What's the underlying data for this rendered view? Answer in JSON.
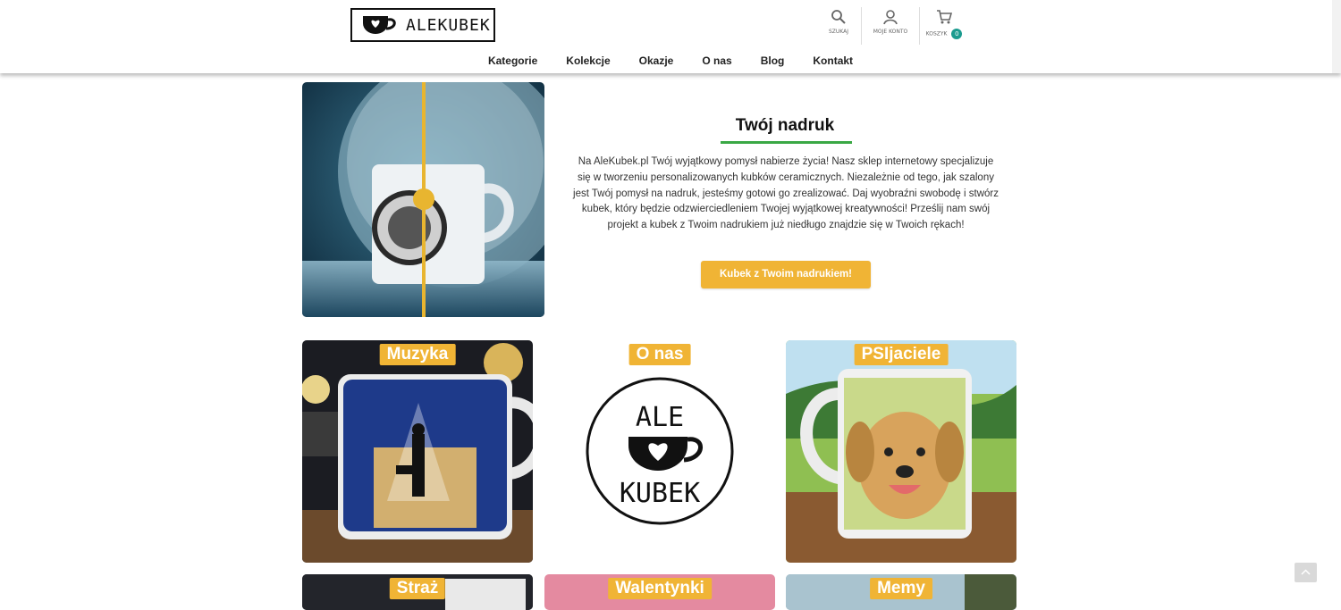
{
  "brand": {
    "logo_text": "ALEKUBEK"
  },
  "header_utils": {
    "search_label": "SZUKAJ",
    "account_label": "MOJE KONTO",
    "cart_label": "KOSZYK",
    "cart_count": "0"
  },
  "nav": {
    "items": [
      "Kategorie",
      "Kolekcje",
      "Okazje",
      "O nas",
      "Blog",
      "Kontakt"
    ]
  },
  "hero": {
    "title": "Twój nadruk",
    "text": "Na AleKubek.pl Twój wyjątkowy pomysł nabierze życia! Nasz sklep internetowy specjalizuje się w tworzeniu personalizowanych kubków ceramicznych. Niezależnie od tego, jak szalony jest Twój pomysł na nadruk, jesteśmy gotowi go zrealizować. Daj wyobraźni swobodę i stwórz kubek, który będzie odzwierciedleniem Twojej wyjątkowej kreatywności! Prześlij nam swój projekt a kubek z Twoim nadrukiem już niedługo znajdzie się w Twoich rękach!",
    "button": "Kubek z Twoim nadrukiem!"
  },
  "tiles": {
    "row1": [
      "Muzyka",
      "O nas",
      "PSIjaciele"
    ],
    "row2": [
      "Straż",
      "Walentynki",
      "Memy"
    ]
  },
  "about_logo": {
    "line1": "ALE",
    "line2": "KUBEK"
  },
  "colors": {
    "accent": "#f0b435",
    "green": "#3aa845",
    "teal": "#1a9b8f"
  }
}
